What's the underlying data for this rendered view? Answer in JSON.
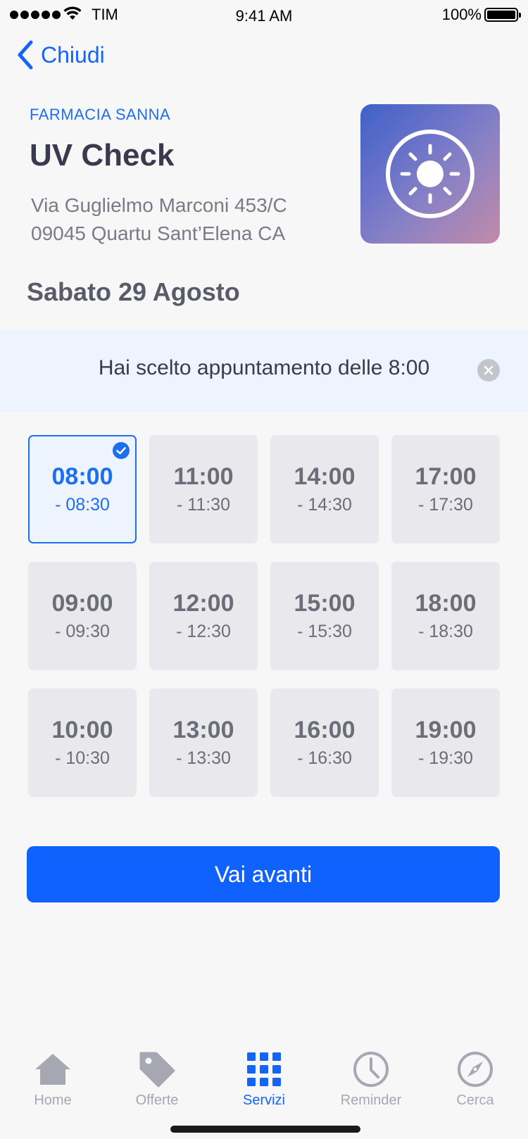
{
  "status_bar": {
    "carrier": "TIM",
    "time": "9:41 AM",
    "battery": "100%"
  },
  "nav": {
    "back_label": "Chiudi"
  },
  "header": {
    "pharmacy": "FARMACIA SANNA",
    "title": "UV Check",
    "address_line1": "Via Guglielmo Marconi 453/C",
    "address_line2": "09045 Quartu Sant’Elena CA"
  },
  "date": "Sabato 29 Agosto",
  "banner": {
    "text": "Hai scelto appuntamento delle 8:00"
  },
  "slots": [
    {
      "start": "08:00",
      "end": "- 08:30",
      "selected": true
    },
    {
      "start": "11:00",
      "end": "- 11:30"
    },
    {
      "start": "14:00",
      "end": "- 14:30"
    },
    {
      "start": "17:00",
      "end": "- 17:30"
    },
    {
      "start": "09:00",
      "end": "- 09:30"
    },
    {
      "start": "12:00",
      "end": "- 12:30"
    },
    {
      "start": "15:00",
      "end": "- 15:30"
    },
    {
      "start": "18:00",
      "end": "- 18:30"
    },
    {
      "start": "10:00",
      "end": "- 10:30"
    },
    {
      "start": "13:00",
      "end": "- 13:30"
    },
    {
      "start": "16:00",
      "end": "- 16:30"
    },
    {
      "start": "19:00",
      "end": "- 19:30"
    }
  ],
  "primary_button": "Vai avanti",
  "tabs": [
    {
      "label": "Home",
      "icon": "home-icon"
    },
    {
      "label": "Offerte",
      "icon": "tag-icon"
    },
    {
      "label": "Servizi",
      "icon": "grid-icon",
      "active": true
    },
    {
      "label": "Reminder",
      "icon": "clock-icon"
    },
    {
      "label": "Cerca",
      "icon": "compass-icon"
    }
  ],
  "colors": {
    "accent": "#1464f6",
    "button": "#0f62fe",
    "slot_bg": "#e8e8ed",
    "selected_bg": "#eef4fd",
    "tab_inactive": "#a6a7b2"
  }
}
